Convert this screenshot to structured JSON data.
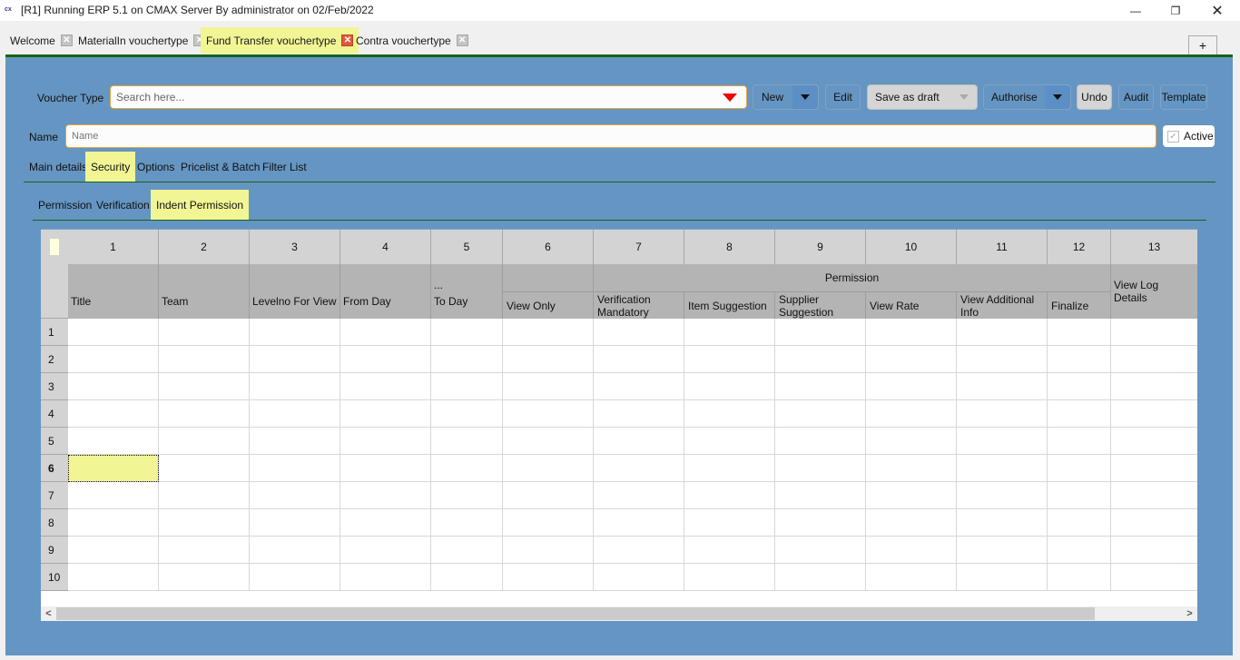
{
  "window": {
    "app_icon": "cx",
    "title": "[R1] Running ERP 5.1 on CMAX Server By administrator on 02/Feb/2022",
    "minimize": "—",
    "maximize": "❐",
    "close": "✕"
  },
  "doc_tabs": [
    {
      "label": "Welcome",
      "active": false
    },
    {
      "label": "MaterialIn vouchertype",
      "active": false
    },
    {
      "label": "Fund Transfer vouchertype",
      "active": true
    },
    {
      "label": "Contra vouchertype",
      "active": false
    }
  ],
  "tab_close_glyph": "✕",
  "add_tab_label": "+",
  "toolbar": {
    "voucher_type_label": "Voucher Type",
    "search_placeholder": "Search here...",
    "new_label": "New",
    "edit_label": "Edit",
    "save_draft_label": "Save as draft",
    "authorise_label": "Authorise",
    "undo_label": "Undo",
    "audit_label": "Audit",
    "template_label": "Template"
  },
  "name_field": {
    "label": "Name",
    "placeholder": "Name",
    "value": ""
  },
  "active_checkbox": {
    "label": "Active",
    "checked": true
  },
  "main_tabs": [
    {
      "label": "Main details",
      "active": false
    },
    {
      "label": "Security",
      "active": true
    },
    {
      "label": "Options",
      "active": false
    },
    {
      "label": "Pricelist & Batch",
      "active": false
    },
    {
      "label": "Filter List",
      "active": false
    }
  ],
  "sub_tabs": [
    {
      "label": "Permission",
      "active": false
    },
    {
      "label": "Verification",
      "active": false
    },
    {
      "label": "Indent Permission",
      "active": true
    }
  ],
  "grid": {
    "column_numbers": [
      "1",
      "2",
      "3",
      "4",
      "5",
      "6",
      "7",
      "8",
      "9",
      "10",
      "11",
      "12",
      "13"
    ],
    "group_header": "Permission",
    "to_day_ellipsis": "...",
    "columns": [
      "Title",
      "Team",
      "Levelno For View",
      "From Day",
      "To Day",
      "View Only",
      "Verification Mandatory",
      "Item Suggestion",
      "Supplier Suggestion",
      "View Rate",
      "View Additional Info",
      "Finalize",
      "View Log Details"
    ],
    "row_numbers": [
      "1",
      "2",
      "3",
      "4",
      "5",
      "6",
      "7",
      "8",
      "9",
      "10"
    ],
    "selected_row": "6",
    "selected_column": "Title"
  },
  "scrollbar": {
    "left_arrow": "<",
    "right_arrow": ">"
  }
}
